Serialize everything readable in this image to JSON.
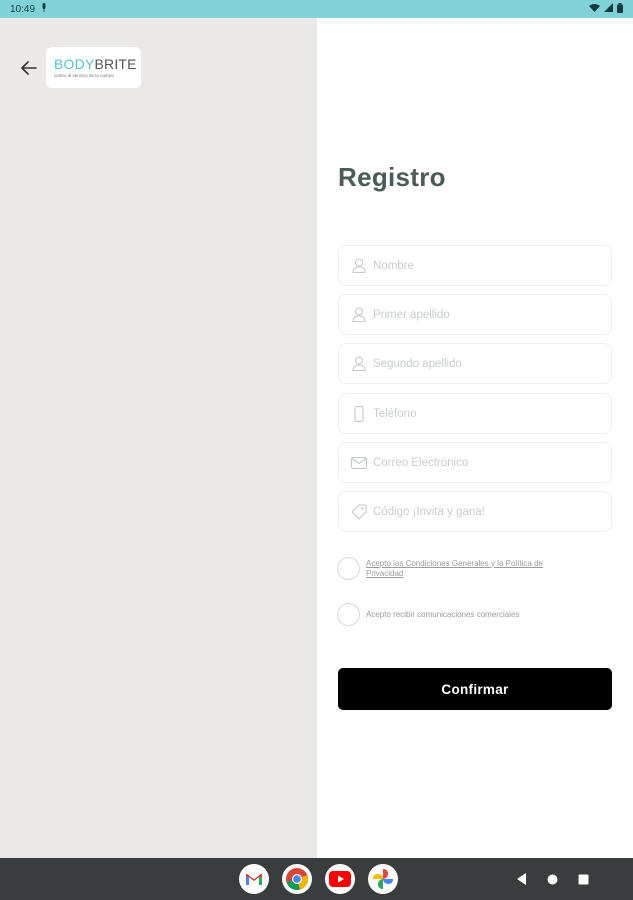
{
  "status_bar": {
    "time": "10:49"
  },
  "header": {
    "logo": {
      "brand_part1": "BODY",
      "brand_part2": "BRITE",
      "tagline": "centro al servicio de tu cuerpo"
    }
  },
  "form": {
    "title": "Registro",
    "fields": [
      {
        "placeholder": "Nombre",
        "icon": "person-icon"
      },
      {
        "placeholder": "Primer apellido",
        "icon": "person-icon"
      },
      {
        "placeholder": "Segundo apellido",
        "icon": "person-icon"
      },
      {
        "placeholder": "Teléfono",
        "icon": "phone-icon"
      },
      {
        "placeholder": "Correo Electrónico",
        "icon": "mail-icon"
      },
      {
        "placeholder": "Código ¡Invita y gana!",
        "icon": "tag-icon"
      }
    ],
    "terms_checkbox_label": "Acepto las Condiciones Generales y la Política de Privacidad",
    "marketing_checkbox_label": "Acepto recibir comunicaciones comerciales",
    "confirm_label": "Confirmar"
  },
  "dock": {
    "apps": [
      "gmail-icon",
      "chrome-icon",
      "youtube-icon",
      "photos-icon"
    ]
  },
  "colors": {
    "status_bar": "#7fd3d8",
    "left_pane": "#ebe9e7",
    "title": "#4a5b58",
    "brand": "#56c3cf",
    "button": "#000000",
    "nav_bar": "#3a3d3e"
  }
}
